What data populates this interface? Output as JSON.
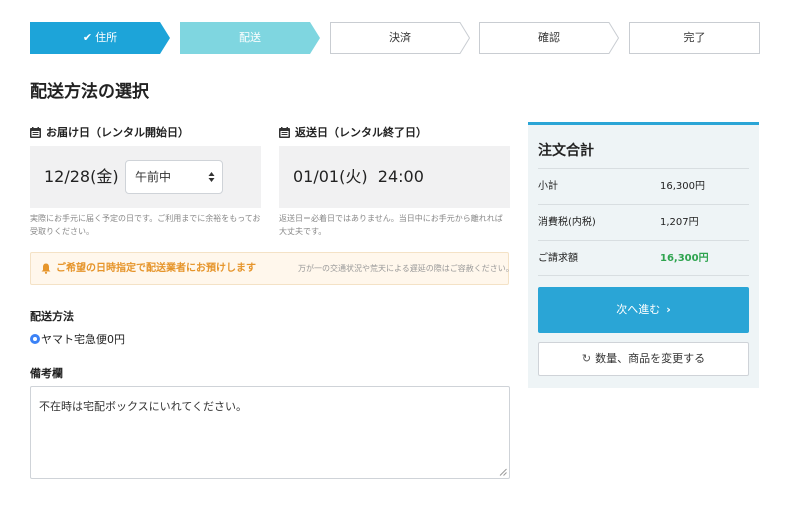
{
  "steps": [
    {
      "label": "住所",
      "state": "done",
      "check": "✔"
    },
    {
      "label": "配送",
      "state": "current"
    },
    {
      "label": "決済",
      "state": "todo"
    },
    {
      "label": "確認",
      "state": "todo"
    },
    {
      "label": "完了",
      "state": "todo"
    }
  ],
  "colors": {
    "done": "#1da4d9",
    "current": "#7fd6e0",
    "accent": "#2aa5d6",
    "warning": "#e6952b",
    "total": "#2ea44f"
  },
  "page_title": "配送方法の選択",
  "delivery": {
    "label": "お届け日（レンタル開始日）",
    "date": "12/28(金)",
    "time_select": "午前中",
    "note": "実際にお手元に届く予定の日です。ご利用までに余裕をもってお受取りください。",
    "icon": "calendar-icon"
  },
  "return": {
    "label": "返送日（レンタル終了日）",
    "datetime": "01/01(火)  24:00",
    "note": "返送日＝必着日ではありません。当日中にお手元から離れれば大丈夫です。",
    "icon": "calendar-icon"
  },
  "notice": {
    "strong": "ご希望の日時指定で配送業者にお預けします",
    "weak": "万が一の交通状況や荒天による遅延の際はご容赦ください。",
    "icon": "bell-icon"
  },
  "shipping": {
    "label": "配送方法",
    "option": "ヤマト宅急便0円"
  },
  "remarks": {
    "label": "備考欄",
    "value": "不在時は宅配ボックスにいれてください。"
  },
  "summary": {
    "title": "注文合計",
    "rows": [
      {
        "label": "小計",
        "value": "16,300円"
      },
      {
        "label": "消費税(内税)",
        "value": "1,207円"
      },
      {
        "label": "ご請求額",
        "value": "16,300円"
      }
    ],
    "next_label": "次へ進む",
    "change_label": "数量、商品を変更する"
  }
}
